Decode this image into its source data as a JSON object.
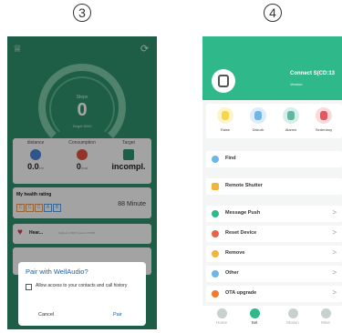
{
  "steps": {
    "left": "3",
    "right": "4"
  },
  "phone3": {
    "gauge": {
      "label": "Steps",
      "value": "0",
      "target": "Target 8000"
    },
    "stats": [
      {
        "label": "distance",
        "value": "0.0",
        "unit": "km",
        "color": "#4a82d8"
      },
      {
        "label": "Consumption",
        "value": "0",
        "unit": "kcal",
        "color": "#e0503c"
      },
      {
        "label": "Target",
        "value": "incompl.",
        "unit": "",
        "color": "#2f8f6c"
      }
    ],
    "rating": {
      "title": "My health rating",
      "chips": [
        "C",
        "C",
        "C",
        "A",
        "B"
      ],
      "minutes": "88 Minute"
    },
    "heart": {
      "title": "Hear...",
      "sub": "Highest 0 BPM    Lowest 0 BPM"
    },
    "dialog": {
      "title": "Pair with WellAudio?",
      "checkbox_text": "Allow access to your contacts and call history",
      "cancel": "Cancel",
      "pair": "Pair"
    }
  },
  "phone4": {
    "connect": "Connect S(CD:13",
    "version": "Version:",
    "quick": [
      {
        "label": "Raise",
        "color": "#f6d64a",
        "bg": "#fdf4cc"
      },
      {
        "label": "Disturb",
        "color": "#6cb6e8",
        "bg": "#dcedf9"
      },
      {
        "label": "Alarms",
        "color": "#5fb8a2",
        "bg": "#d7efe8"
      },
      {
        "label": "Sedentary",
        "color": "#e6565e",
        "bg": "#fadadc"
      }
    ],
    "menu": [
      {
        "label": "Find",
        "color": "#6cb6e8",
        "arrow": ""
      },
      {
        "label": "Remote Shutter",
        "color": "#f2b43a",
        "arrow": ""
      },
      {
        "label": "Message Push",
        "color": "#2fb889",
        "arrow": ">"
      },
      {
        "label": "Reset Device",
        "color": "#e8634a",
        "arrow": ">"
      },
      {
        "label": "Remove",
        "color": "#f2b43a",
        "arrow": ">"
      },
      {
        "label": "Other",
        "color": "#6cb6e8",
        "arrow": ">"
      },
      {
        "label": "OTA upgrade",
        "color": "#f07a2a",
        "arrow": ">"
      }
    ],
    "tabs": [
      {
        "label": "Home"
      },
      {
        "label": "Set"
      },
      {
        "label": "Motion"
      },
      {
        "label": "Mine"
      }
    ]
  }
}
